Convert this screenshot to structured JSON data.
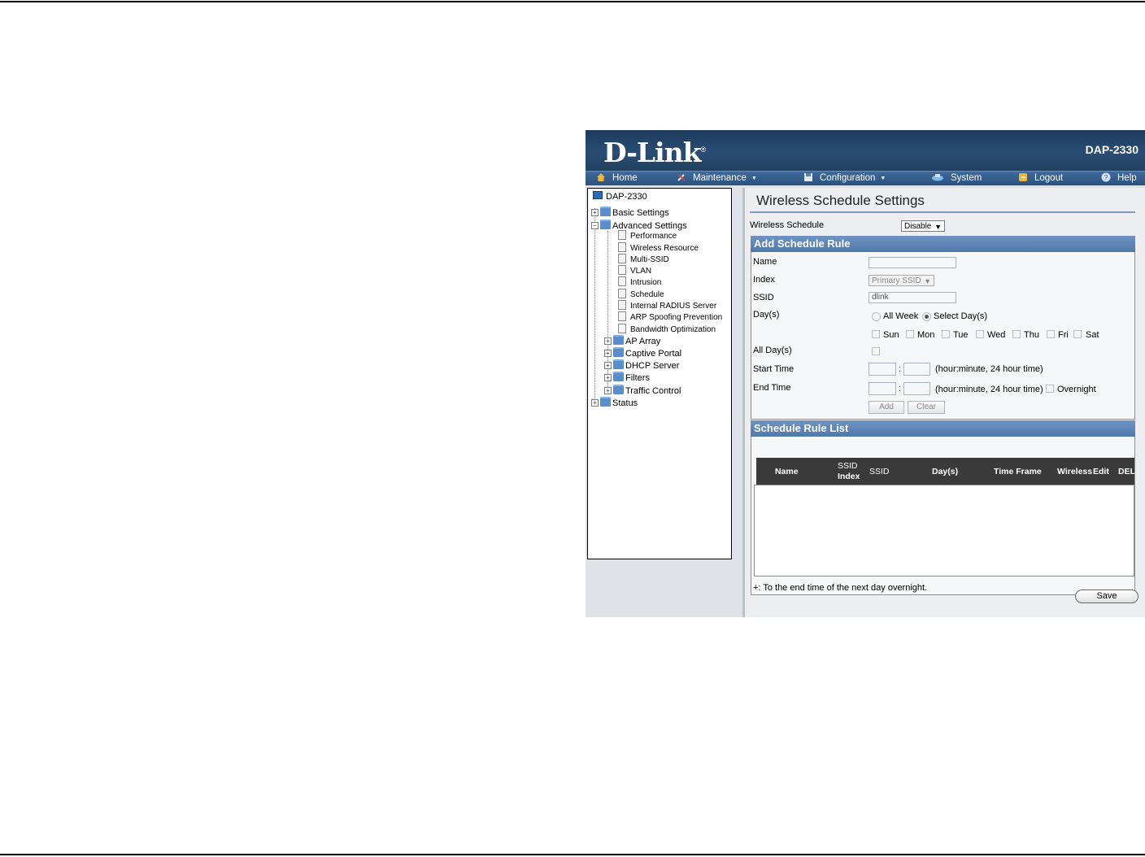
{
  "app": {
    "brand": "D-Link",
    "model": "DAP-2330"
  },
  "nav": {
    "home": "Home",
    "maintenance": "Maintenance",
    "configuration": "Configuration",
    "system": "System",
    "logout": "Logout",
    "help": "Help"
  },
  "tree": {
    "root": "DAP-2330",
    "basic_settings": "Basic Settings",
    "advanced_settings": "Advanced Settings",
    "advanced_items": [
      "Performance",
      "Wireless Resource",
      "Multi-SSID",
      "VLAN",
      "Intrusion",
      "Schedule",
      "Internal RADIUS Server",
      "ARP Spoofing Prevention",
      "Bandwidth Optimization"
    ],
    "folders": [
      "AP Array",
      "Captive Portal",
      "DHCP Server",
      "Filters",
      "Traffic Control"
    ],
    "status": "Status"
  },
  "content": {
    "title": "Wireless Schedule Settings",
    "wireless_schedule_label": "Wireless Schedule",
    "wireless_schedule_value": "Disable",
    "add_rule": {
      "heading": "Add Schedule Rule",
      "name_label": "Name",
      "name_value": "",
      "index_label": "Index",
      "index_value": "Primary SSID",
      "ssid_label": "SSID",
      "ssid_value": "dlink",
      "days_label": "Day(s)",
      "all_week": "All Week",
      "select_days": "Select Day(s)",
      "days": [
        "Sun",
        "Mon",
        "Tue",
        "Wed",
        "Thu",
        "Fri",
        "Sat"
      ],
      "all_days_label": "All Day(s)",
      "start_time_label": "Start Time",
      "end_time_label": "End Time",
      "time_hint": "(hour:minute, 24 hour time)",
      "time_sep": ":",
      "overnight": "Overnight",
      "add_button": "Add",
      "clear_button": "Clear"
    },
    "rule_list": {
      "heading": "Schedule Rule List",
      "columns": {
        "name": "Name",
        "ssid_index_1": "SSID",
        "ssid_index_2": "Index",
        "ssid": "SSID",
        "days": "Day(s)",
        "time_frame": "Time Frame",
        "wireless": "Wireless",
        "edit": "Edit",
        "del": "DEL"
      },
      "rows": []
    },
    "footnote": "+: To the end time of the next day overnight.",
    "save_button": "Save"
  }
}
